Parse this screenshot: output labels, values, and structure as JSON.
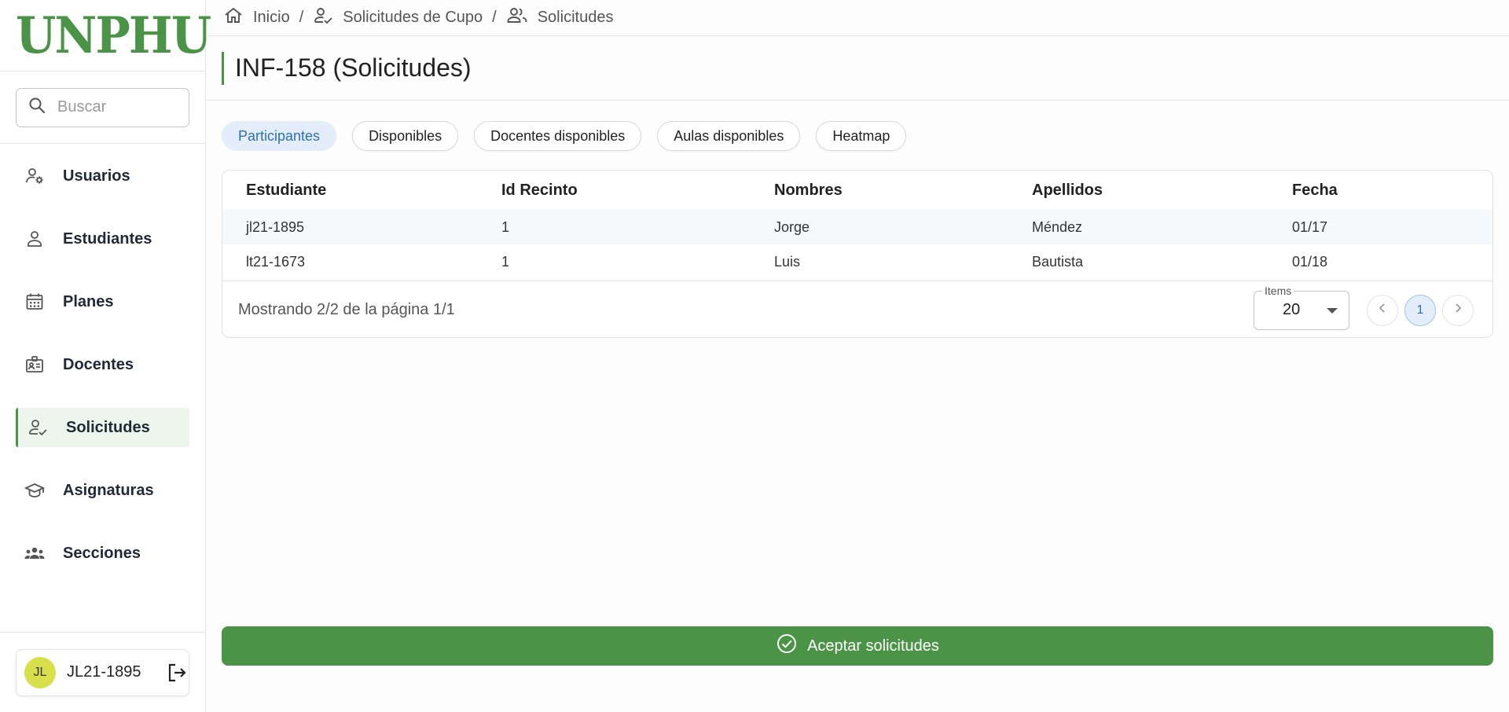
{
  "brand": {
    "logo_text": "UNPHU",
    "color": "#4b9447"
  },
  "search": {
    "placeholder": "Buscar"
  },
  "sidebar": {
    "items": [
      {
        "label": "Usuarios",
        "icon": "user-settings-icon"
      },
      {
        "label": "Estudiantes",
        "icon": "person-icon"
      },
      {
        "label": "Planes",
        "icon": "calendar-icon"
      },
      {
        "label": "Docentes",
        "icon": "badge-icon"
      },
      {
        "label": "Solicitudes",
        "icon": "person-check-icon",
        "active": true
      },
      {
        "label": "Asignaturas",
        "icon": "graduation-cap-icon"
      },
      {
        "label": "Secciones",
        "icon": "groups-icon"
      }
    ]
  },
  "user": {
    "initials": "JL",
    "name": "JL21-1895",
    "avatar_color": "#d7e04a"
  },
  "breadcrumb": {
    "items": [
      "Inicio",
      "Solicitudes de Cupo",
      "Solicitudes"
    ],
    "separator": "/"
  },
  "page": {
    "title": "INF-158 (Solicitudes)"
  },
  "tabs": [
    {
      "label": "Participantes",
      "active": true
    },
    {
      "label": "Disponibles"
    },
    {
      "label": "Docentes disponibles"
    },
    {
      "label": "Aulas disponibles"
    },
    {
      "label": "Heatmap"
    }
  ],
  "table": {
    "columns": [
      "Estudiante",
      "Id Recinto",
      "Nombres",
      "Apellidos",
      "Fecha"
    ],
    "rows": [
      [
        "jl21-1895",
        "1",
        "Jorge",
        "Méndez",
        "01/17"
      ],
      [
        "lt21-1673",
        "1",
        "Luis",
        "Bautista",
        "01/18"
      ]
    ],
    "footer": {
      "showing": "Mostrando 2/2 de la página 1/1",
      "items_label": "Items",
      "items_value": "20",
      "current_page": "1"
    }
  },
  "actions": {
    "accept_label": "Aceptar solicitudes"
  }
}
